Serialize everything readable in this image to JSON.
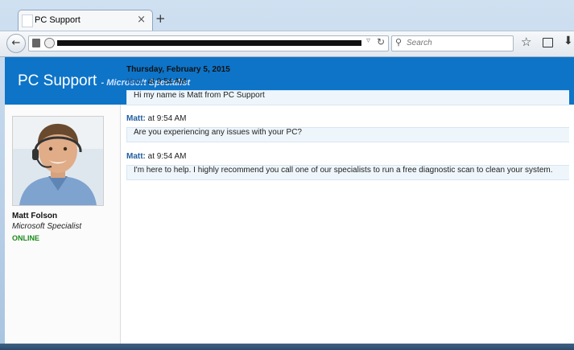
{
  "browser": {
    "tab_title": "PC Support",
    "tab_close": "×",
    "new_tab": "+",
    "search_placeholder": "Search",
    "icons": [
      "back-arrow-icon",
      "site-info-icon",
      "globe-icon",
      "dropdown-icon",
      "reload-icon",
      "search-icon",
      "star-icon",
      "reading-list-icon",
      "download-icon"
    ]
  },
  "header": {
    "brand": "PC Support",
    "subtitle": "- Microsoft Specialist",
    "color": "#0d74c8"
  },
  "agent": {
    "name": "Matt Folson",
    "title": "Microsoft Specialist",
    "status": "ONLINE",
    "status_color": "#1a8a1a"
  },
  "chat": {
    "date": "Thursday, February 5, 2015",
    "messages": [
      {
        "sender": "Matt:",
        "time": "at 9:54 AM",
        "text": "Hi my name is Matt from PC Support"
      },
      {
        "sender": "Matt:",
        "time": "at 9:54 AM",
        "text": "Are you experiencing any issues with your PC?"
      },
      {
        "sender": "Matt:",
        "time": "at 9:54 AM",
        "text": "I'm here to help. I highly recommend you call one of our specialists to run a free diagnostic scan to clean your system."
      }
    ]
  }
}
